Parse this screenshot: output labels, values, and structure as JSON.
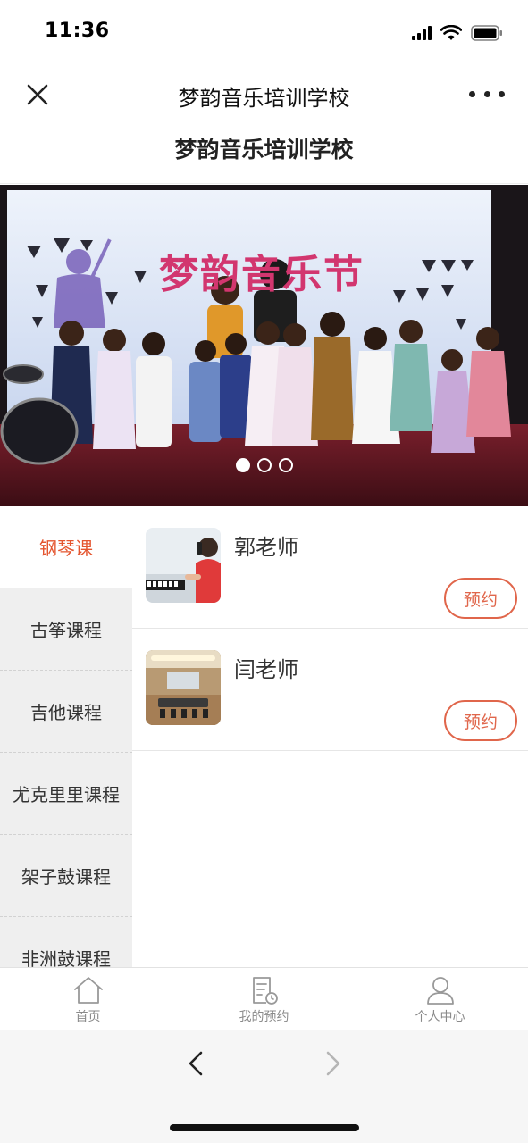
{
  "status_bar": {
    "time": "11:36"
  },
  "nav": {
    "title": "梦韵音乐培训学校"
  },
  "page": {
    "title": "梦韵音乐培训学校"
  },
  "banner": {
    "sign_text": "梦韵音乐节",
    "slide_count": 3,
    "active_slide": 1
  },
  "sidebar": {
    "items": [
      {
        "label": "钢琴课"
      },
      {
        "label": "古筝课程"
      },
      {
        "label": "吉他课程"
      },
      {
        "label": "尤克里里课程"
      },
      {
        "label": "架子鼓课程"
      },
      {
        "label": "非洲鼓课程"
      }
    ]
  },
  "teachers": [
    {
      "name": "郭老师",
      "book_label": "预约"
    },
    {
      "name": "闫老师",
      "book_label": "预约"
    }
  ],
  "tab_bar": {
    "items": [
      {
        "label": "首页",
        "icon": "home-icon"
      },
      {
        "label": "我的预约",
        "icon": "booking-icon"
      },
      {
        "label": "个人中心",
        "icon": "user-icon"
      }
    ]
  },
  "colors": {
    "accent": "#e4552f",
    "button_border": "#e0664b",
    "sidebar_bg": "#efefef"
  }
}
